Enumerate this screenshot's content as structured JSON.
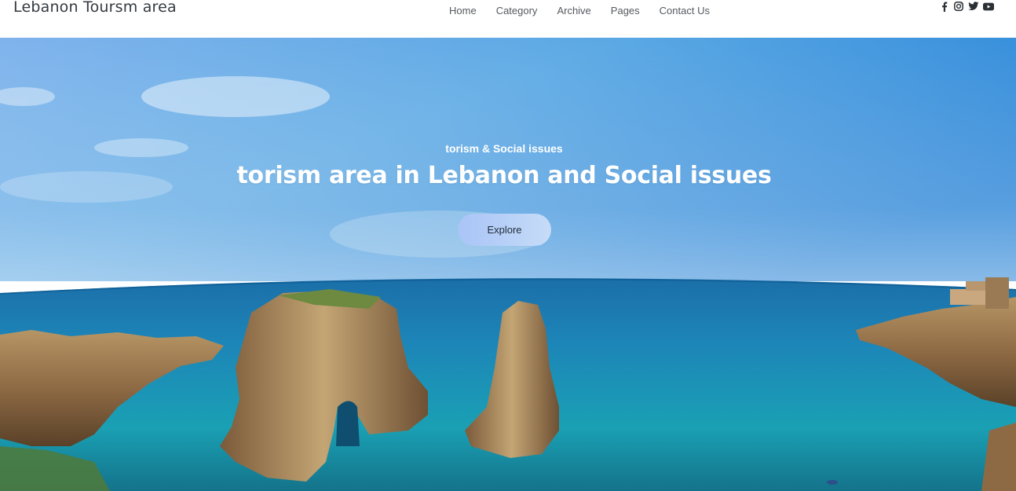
{
  "header": {
    "brand": "Lebanon Toursm area",
    "nav": [
      {
        "label": "Home"
      },
      {
        "label": "Category"
      },
      {
        "label": "Archive"
      },
      {
        "label": "Pages"
      },
      {
        "label": "Contact Us"
      }
    ],
    "social_icons": [
      "facebook-icon",
      "instagram-icon",
      "twitter-icon",
      "youtube-icon"
    ]
  },
  "hero": {
    "subtitle": "torism & Social issues",
    "title": "torism area in Lebanon and Social issues",
    "button_label": "Explore"
  },
  "colors": {
    "brand_text": "#333a40",
    "nav_text": "#555a60",
    "button_bg_start": "#a9c4f7",
    "button_bg_end": "#c6dcf7",
    "sky": "#4a97df",
    "sea": "#1f7fb8"
  }
}
